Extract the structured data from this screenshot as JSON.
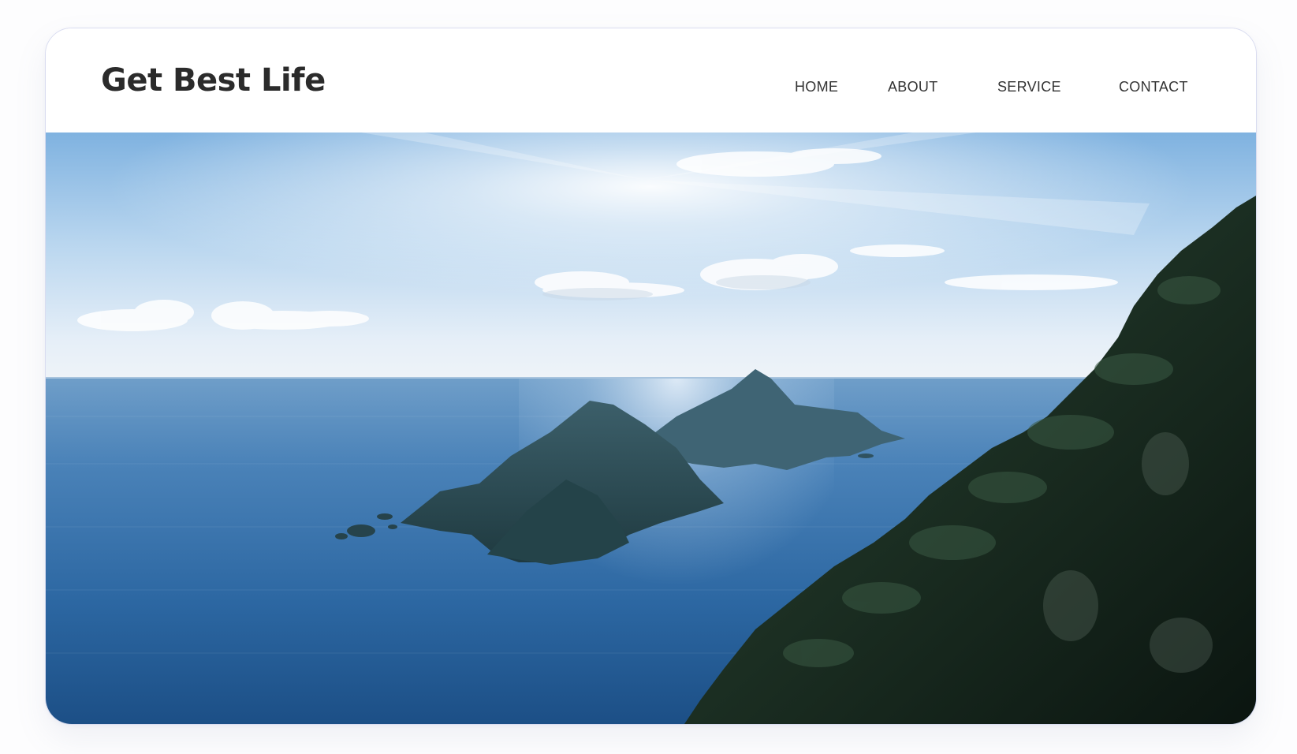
{
  "site": {
    "logo": "Get Best Life"
  },
  "nav": {
    "items": [
      {
        "label": "HOME"
      },
      {
        "label": "ABOUT"
      },
      {
        "label": "SERVICE"
      },
      {
        "label": "CONTACT"
      }
    ]
  },
  "hero": {
    "image": "coastal-landscape-photo"
  },
  "colors": {
    "logo_text": "#2b2b2b",
    "nav_text": "#333333",
    "card_border": "#d9dcf0",
    "sky_top": "#7fb3e0",
    "sea_deep": "#1f5a93"
  }
}
